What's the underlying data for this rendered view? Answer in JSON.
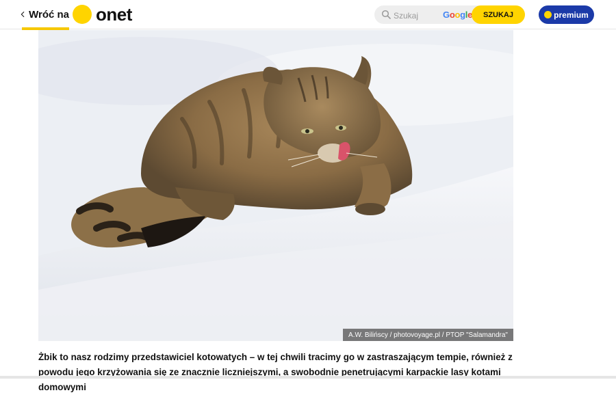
{
  "header": {
    "back_label": "Wróć na",
    "logo_text": "onet",
    "search": {
      "placeholder": "Szukaj",
      "provider": [
        "G",
        "o",
        "o",
        "g",
        "l",
        "e"
      ],
      "button_label": "SZUKAJ"
    },
    "premium_label": "premium"
  },
  "photo": {
    "credit": "A.W. Bilińscy / photovoyage.pl / PTOP \"Salamandra\"",
    "subject": "wildcat-in-snow"
  },
  "caption": "Żbik to nasz rodzimy przedstawiciel kotowatych – w tej chwili tracimy go w zastraszającym tempie, również z powodu jego krzyżowania się ze znacznie liczniejszymi, a swobodnie penetrującymi karpackie lasy kotami domowymi",
  "colors": {
    "accent_yellow": "#ffd400",
    "premium_blue": "#1b3aa8"
  }
}
